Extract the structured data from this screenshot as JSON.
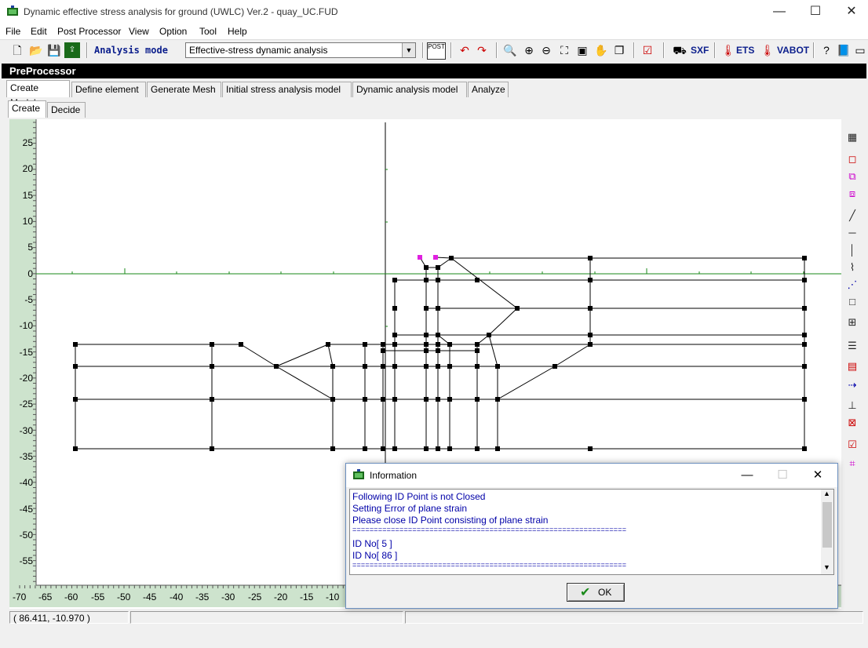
{
  "window": {
    "title": "Dynamic effective stress analysis for ground (UWLC) Ver.2 - quay_UC.FUD",
    "min_glyph": "—",
    "max_glyph": "☐",
    "close_glyph": "✕"
  },
  "menu": [
    "File",
    "Edit",
    "Post Processor",
    "View",
    "Option",
    "Tool",
    "Help"
  ],
  "toolbar": {
    "mode_label": "Analysis mode",
    "mode_value": "Effective-stress dynamic analysis",
    "post_label": "POST",
    "sxf": "SXF",
    "ets": "ETS",
    "vabot": "VABOT"
  },
  "panel_title": "PreProcessor",
  "tabs_main": [
    "Create Model",
    "Define element",
    "Generate Mesh",
    "Initial stress analysis model",
    "Dynamic analysis model",
    "Analyze"
  ],
  "tabs_sub": [
    "Create",
    "Decide"
  ],
  "axis": {
    "y_ticks": [
      "25",
      "20",
      "15",
      "10",
      "5",
      "0",
      "-5",
      "-10",
      "-15",
      "-20",
      "-25",
      "-30",
      "-35",
      "-40",
      "-45",
      "-50",
      "-55"
    ],
    "x_ticks": [
      "-70",
      "-65",
      "-60",
      "-55",
      "-50",
      "-45",
      "-40",
      "-35",
      "-30",
      "-25",
      "-20",
      "-15",
      "-10"
    ]
  },
  "status": {
    "coords": "( 86.411,  -10.970 )"
  },
  "dialog": {
    "title": "Information",
    "lines": [
      "Following ID Point is not Closed",
      "Setting Error of plane strain",
      "Please close ID Point consisting of plane strain",
      "================================================================",
      "ID No[ 5 ]",
      "ID No[ 86 ]",
      "================================================================"
    ],
    "ok_label": "OK"
  },
  "colors": {
    "axis_green": "#1a8a1a",
    "node_black": "#000000",
    "node_magenta": "#e020e0",
    "message_blue": "#0000a8"
  }
}
